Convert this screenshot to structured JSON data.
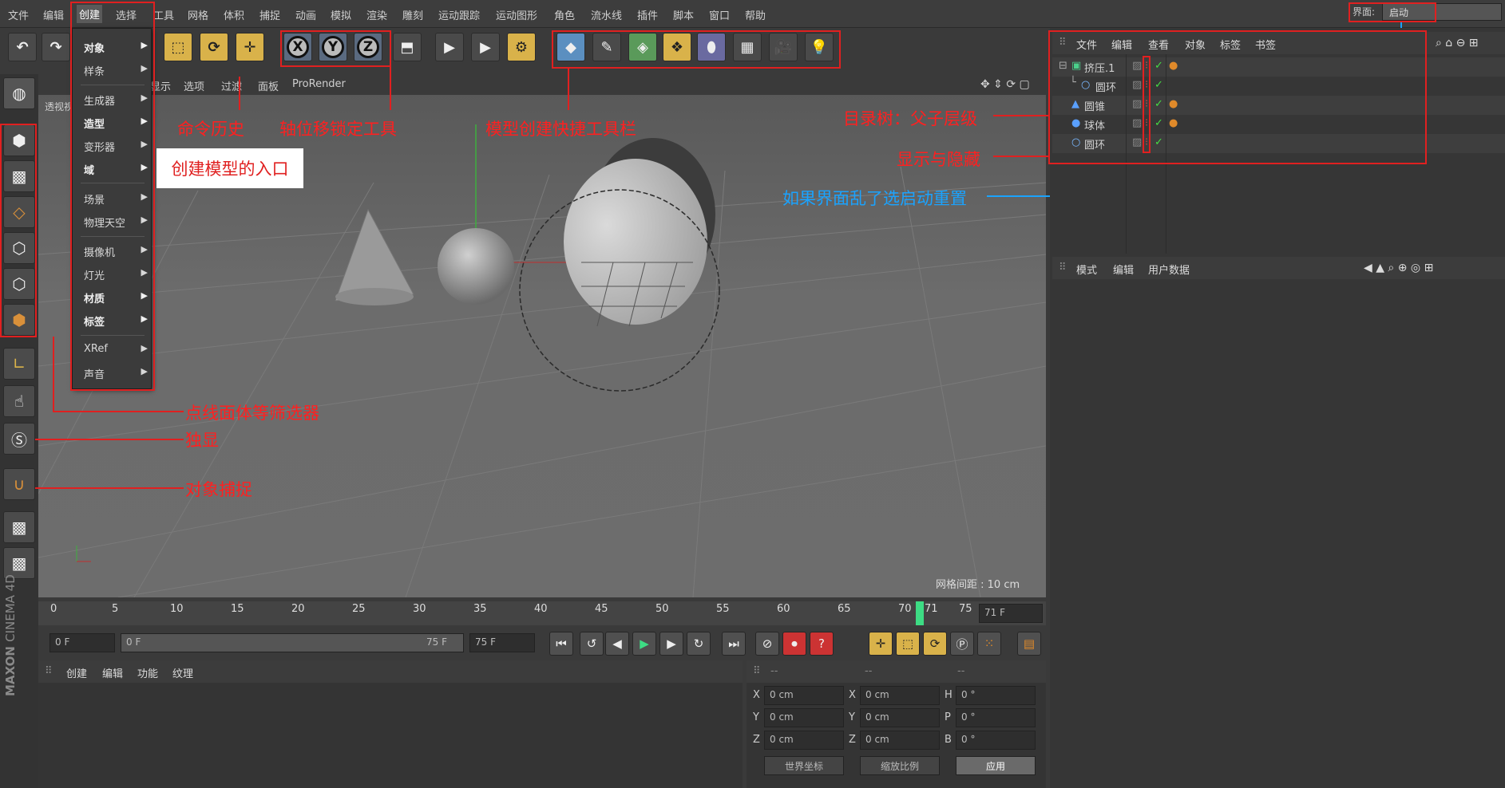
{
  "menubar": {
    "items": [
      "文件",
      "编辑",
      "创建",
      "选择",
      "工具",
      "网格",
      "体积",
      "捕捉",
      "动画",
      "模拟",
      "渲染",
      "雕刻",
      "运动跟踪",
      "运动图形",
      "角色",
      "流水线",
      "插件",
      "脚本",
      "窗口",
      "帮助"
    ],
    "interface_label": "界面:",
    "interface_value": "启动"
  },
  "toolbar": {
    "xyz": [
      "X",
      "Y",
      "Z"
    ]
  },
  "viewport": {
    "menus": [
      "显示",
      "选项",
      "过滤",
      "面板",
      "ProRender"
    ],
    "view_label": "透视视",
    "grid_status": "网格间距 : 10 cm"
  },
  "dropdown": {
    "items": [
      {
        "label": "对象",
        "bold": true
      },
      {
        "label": "样条",
        "bold": false
      },
      {
        "label": "生成器",
        "bold": false
      },
      {
        "label": "造型",
        "bold": true
      },
      {
        "label": "变形器",
        "bold": false
      },
      {
        "label": "域",
        "bold": true
      },
      {
        "label": "场景",
        "bold": false
      },
      {
        "label": "物理天空",
        "bold": false
      },
      {
        "label": "摄像机",
        "bold": false
      },
      {
        "label": "灯光",
        "bold": false
      },
      {
        "label": "材质",
        "bold": true
      },
      {
        "label": "标签",
        "bold": true
      },
      {
        "label": "XRef",
        "bold": false
      },
      {
        "label": "声音",
        "bold": false
      }
    ]
  },
  "annotations": {
    "cmd_history": "命令历史",
    "axis_lock": "轴位移锁定工具",
    "model_shortcut": "模型创建快捷工具栏",
    "create_entry": "创建模型的入口",
    "tree": "目录树：父子层级",
    "visibility": "显示与隐藏",
    "restore": "如果界面乱了选启动重置",
    "filter": "点线面体等筛选器",
    "solo": "独显",
    "snap": "对象捕捉"
  },
  "object_manager": {
    "menus": [
      "文件",
      "编辑",
      "查看",
      "对象",
      "标签",
      "书签"
    ],
    "rows": [
      {
        "name": "挤压.1",
        "indent": 0
      },
      {
        "name": "圆环",
        "indent": 1
      },
      {
        "name": "圆锥",
        "indent": 0
      },
      {
        "name": "球体",
        "indent": 0
      },
      {
        "name": "圆环",
        "indent": 0
      }
    ]
  },
  "attribute_manager": {
    "menus": [
      "模式",
      "编辑",
      "用户数据"
    ]
  },
  "timeline": {
    "ticks": [
      "0",
      "5",
      "10",
      "15",
      "20",
      "25",
      "30",
      "35",
      "40",
      "45",
      "50",
      "55",
      "60",
      "65",
      "70",
      "71",
      "75"
    ],
    "current_frame": "71 F"
  },
  "transport": {
    "start": "0 F",
    "range_start": "0 F",
    "range_end": "75 F",
    "end": "75 F"
  },
  "material_manager": {
    "menus": [
      "创建",
      "编辑",
      "功能",
      "纹理"
    ]
  },
  "coordinates": {
    "header": [
      "--",
      "--",
      "--"
    ],
    "rows": [
      {
        "a": "X",
        "av": "0 cm",
        "b": "X",
        "bv": "0 cm",
        "c": "H",
        "cv": "0 °"
      },
      {
        "a": "Y",
        "av": "0 cm",
        "b": "Y",
        "bv": "0 cm",
        "c": "P",
        "cv": "0 °"
      },
      {
        "a": "Z",
        "av": "0 cm",
        "b": "Z",
        "bv": "0 cm",
        "c": "B",
        "cv": "0 °"
      }
    ],
    "world": "世界坐标",
    "scale": "缩放比例",
    "apply": "应用"
  },
  "brand": {
    "line1": "MAXON",
    "line2": "CINEMA 4D"
  },
  "colors": {
    "annotation_red": "#e02020",
    "annotation_blue": "#1aa3ff",
    "accent_gold": "#d9b24a",
    "timeline_marker": "#3ddc84"
  }
}
